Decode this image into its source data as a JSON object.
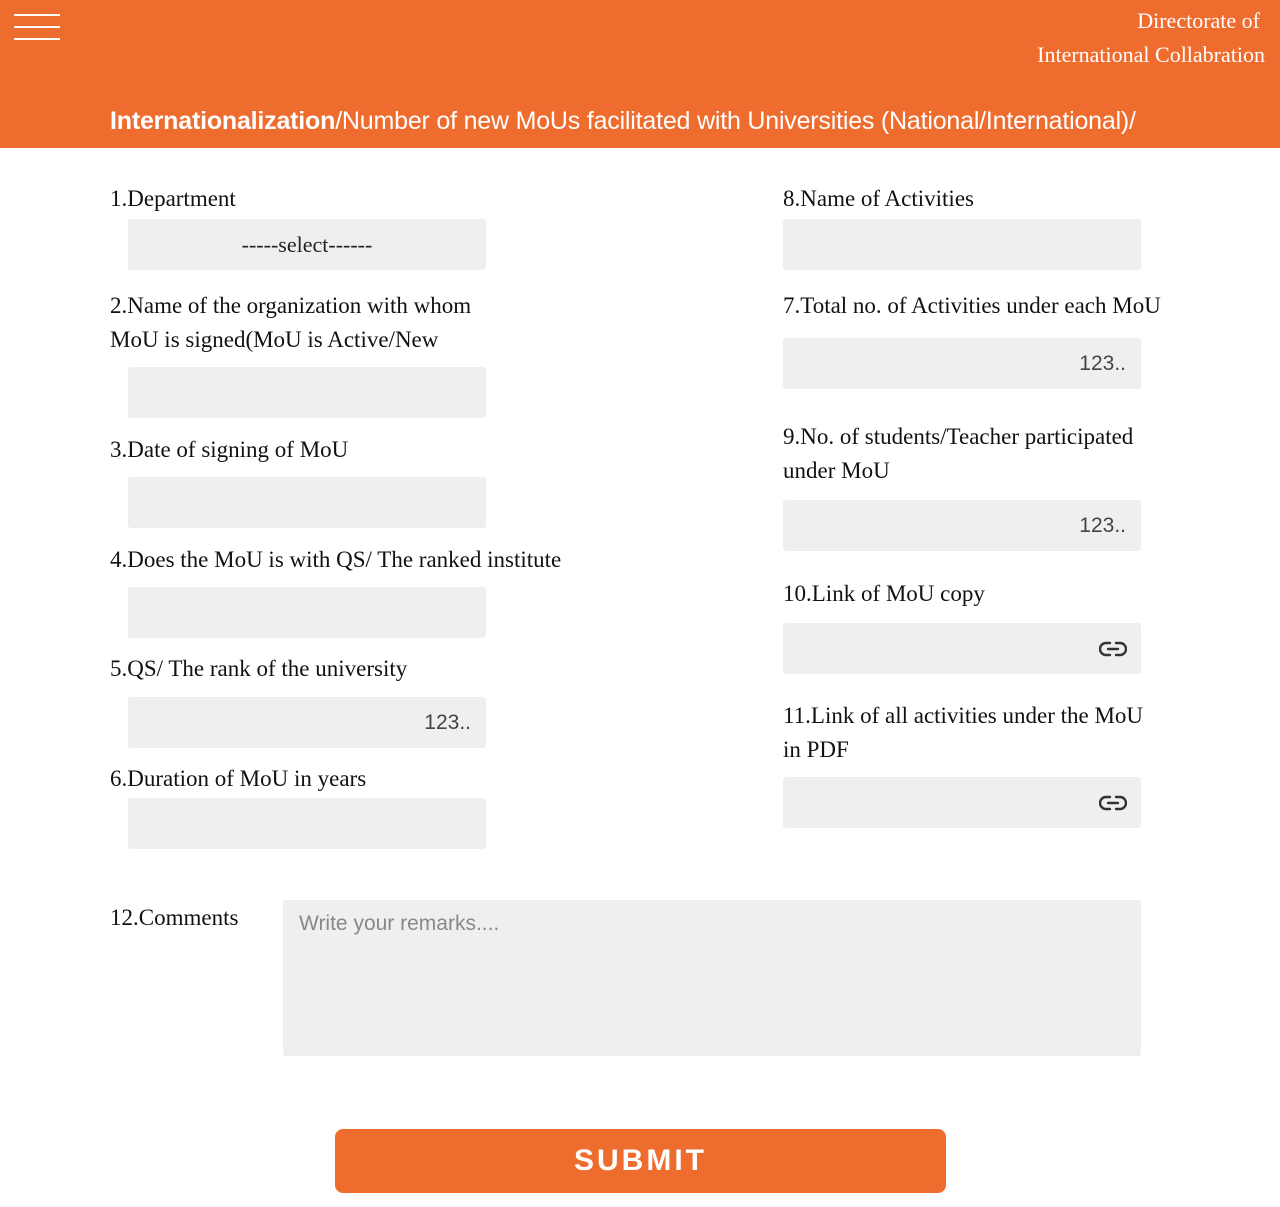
{
  "header": {
    "brand_line1": "Directorate of",
    "brand_line2": "International Collabration",
    "breadcrumb_link": "Internationalization",
    "breadcrumb_rest": "/Number of new MoUs facilitated with Universities (National/International)/",
    "menu_icon": "hamburger-menu-icon"
  },
  "form": {
    "q1": {
      "label": "1.Department",
      "value": "-----select------"
    },
    "q2": {
      "label_line1": "2.Name of the organization with whom",
      "label_line2": "MoU is signed(MoU is Active/New"
    },
    "q3": {
      "label": "3.Date of signing of MoU"
    },
    "q4": {
      "label": "4.Does the MoU is with QS/ The ranked institute"
    },
    "q5": {
      "label": "5.QS/ The rank of the university",
      "placeholder": "123.."
    },
    "q6": {
      "label": "6.Duration of MoU in years"
    },
    "q8": {
      "label": "8.Name of Activities"
    },
    "q7": {
      "label": "7.Total no. of Activities under each MoU",
      "placeholder": "123.."
    },
    "q9": {
      "label_line1": "9.No. of students/Teacher participated",
      "label_line2": "under MoU",
      "placeholder": "123.."
    },
    "q10": {
      "label": "10.Link of MoU copy",
      "icon": "link-icon"
    },
    "q11": {
      "label_line1": "11.Link of all activities under the MoU",
      "label_line2": "in PDF",
      "icon": "link-icon"
    },
    "q12": {
      "label": "12.Comments",
      "placeholder": "Write your remarks...."
    },
    "submit_label": "SUBMIT"
  }
}
